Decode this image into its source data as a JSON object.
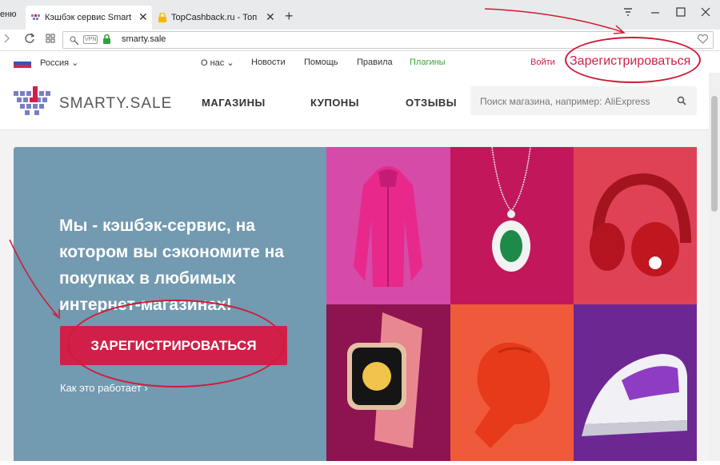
{
  "browser": {
    "menu_label": "еню",
    "tabs": [
      {
        "title": "Кэшбэк сервис Smarty.Sa",
        "close": "✕"
      },
      {
        "title": "TopCashback.ru - Топ луч",
        "close": "✕"
      }
    ],
    "new_tab": "+",
    "url": "smarty.sale",
    "vpn_badge": "VPN"
  },
  "topline": {
    "region": "Россия",
    "links": {
      "about": "О нас",
      "news": "Новости",
      "help": "Помощь",
      "rules": "Правила",
      "plugins": "Плагины"
    },
    "login": "Войти",
    "register": "Зарегистрироваться"
  },
  "header": {
    "logo_main": "SMARTY",
    "logo_dot": ".",
    "logo_tail": "SALE",
    "nav": {
      "stores": "МАГАЗИНЫ",
      "coupons": "КУПОНЫ",
      "reviews": "ОТЗЫВЫ"
    },
    "search_placeholder": "Поиск магазина, например: AliExpress"
  },
  "hero": {
    "headline": "Мы - кэшбэк-сервис, на котором вы сэкономите на покупках в любимых интернет-магазинах!",
    "cta": "ЗАРЕГИСТРИРОВАТЬСЯ",
    "how_it_works": "Как это работает ›"
  },
  "colors": {
    "brand": "#d0204a",
    "hero_bg": "#729ab0",
    "plugins_link": "#3aa03a",
    "annotation": "#d11a35"
  },
  "tiles": [
    {
      "name": "jacket",
      "bg": "#d64aa8"
    },
    {
      "name": "pendant",
      "bg": "#c2185b"
    },
    {
      "name": "headphones",
      "bg": "#e04255"
    },
    {
      "name": "watch",
      "bg": "#8e1351"
    },
    {
      "name": "boxing-glove",
      "bg": "#ef5a3a"
    },
    {
      "name": "iron",
      "bg": "#6d2792"
    }
  ]
}
